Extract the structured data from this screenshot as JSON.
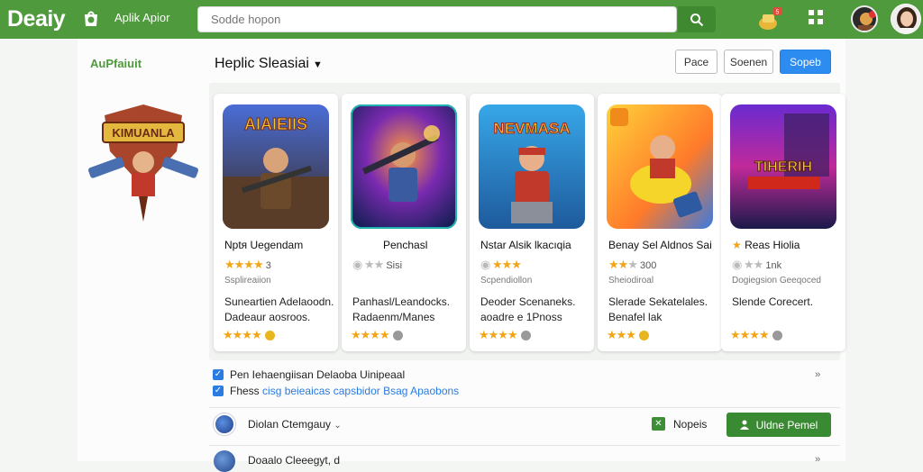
{
  "header": {
    "brand": "Deaiy",
    "subtitle": "Aplik Apior",
    "search_placeholder": "Sodde hopon",
    "gift_badge": "5"
  },
  "sidebar": {
    "label": "AuPfaiuit",
    "logo_text": "KIMUANLA"
  },
  "section": {
    "title": "Heplic Sleasiai",
    "buttons": [
      "Pace",
      "Soenen",
      "Sopeb"
    ]
  },
  "cards": [
    {
      "art_text": "AIAIEIIS",
      "title": "Nptя Uegendam",
      "rating_text": "3",
      "category": "Ssplireaiion",
      "desc1": "Suneartien Adelaoodn.",
      "desc2": "Dadeaur aosroos."
    },
    {
      "art_text": "",
      "title": "Penchasl",
      "rating_text": "Sisi",
      "category": "",
      "desc1": "Panhasl/Leandocks.",
      "desc2": "Radaenm/Manes"
    },
    {
      "art_text": "NEVMASA",
      "title": "Nstar Alsik lkacıqia",
      "rating_text": "",
      "category": "Scpendiollon",
      "desc1": "Deoder Scenaneks.",
      "desc2": "aoadre e 1Pnoss"
    },
    {
      "art_text": "",
      "title": "Benay Sel Aldnos Sai",
      "rating_text": "300",
      "category": "Sheiodiroal",
      "desc1": "Slerade Sekatelales.",
      "desc2": "Benafel lak"
    },
    {
      "art_text": "TIHERIH",
      "title": "Reas Hiolia",
      "rating_text": "1nk",
      "category": "Dogiegsion Geeqoced",
      "desc1": "Slende Corecert.",
      "desc2": ""
    }
  ],
  "checkbox_rows": [
    {
      "text": "Pen Iehaengiisan Delaoba Uinipeaal",
      "blue_text": ""
    },
    {
      "text": "Fhess",
      "blue_text": "cisg beieaicas capsbidor Bsag Apaobons"
    }
  ],
  "category_row": {
    "label": "Diolan Ctemgauy",
    "check_label": "Nopeis",
    "install_label": "Uldne Pemel"
  },
  "row2": {
    "label": "Doaalo Cleeegyt, d"
  },
  "colors": {
    "header_green": "#4f9a3c",
    "primary_blue": "#2d8cf0",
    "install_green": "#3a8a33",
    "star_gold": "#f2a516"
  }
}
